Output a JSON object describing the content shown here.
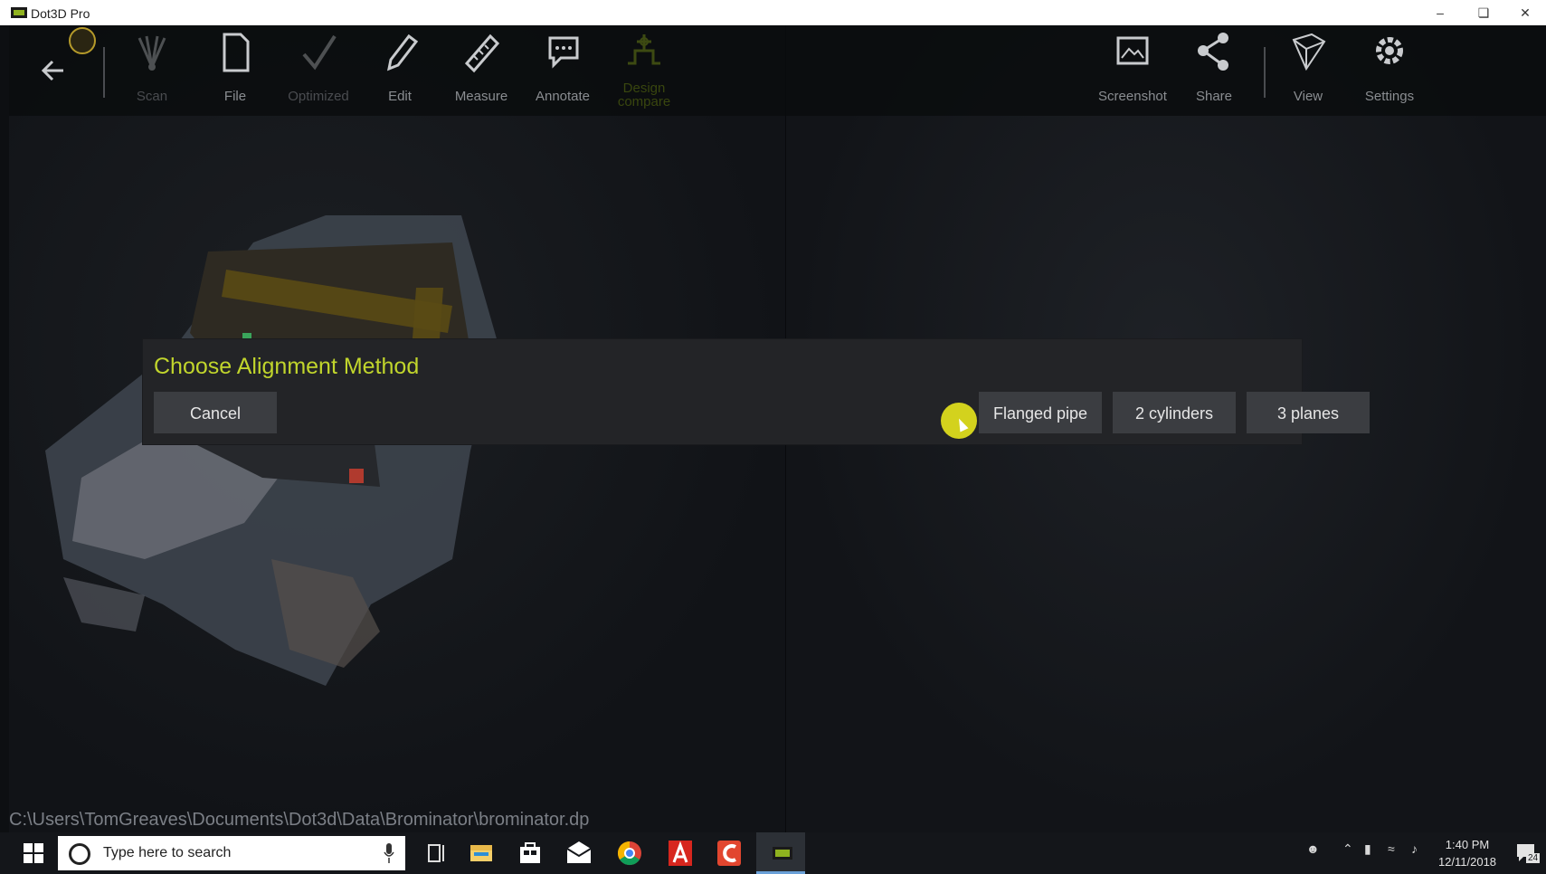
{
  "window": {
    "title": "Dot3D Pro",
    "min_icon": "minimize-icon",
    "restore_icon": "restore-icon",
    "close_icon": "close-icon"
  },
  "toolbar": {
    "left_tools": [
      {
        "label": "Scan",
        "icon": "scan-icon"
      },
      {
        "label": "File",
        "icon": "file-icon"
      },
      {
        "label": "Optimized",
        "icon": "check-icon"
      },
      {
        "label": "Edit",
        "icon": "pencil-icon"
      },
      {
        "label": "Measure",
        "icon": "ruler-icon"
      },
      {
        "label": "Annotate",
        "icon": "speech-bubble-icon"
      },
      {
        "label": "Design compare",
        "icon": "design-compare-icon"
      }
    ],
    "right_tools": [
      {
        "label": "Screenshot",
        "icon": "screenshot-icon"
      },
      {
        "label": "Share",
        "icon": "share-icon"
      },
      {
        "label": "View",
        "icon": "cube-icon"
      },
      {
        "label": "Settings",
        "icon": "gear-icon"
      }
    ]
  },
  "dialog": {
    "title": "Choose Alignment Method",
    "cancel_label": "Cancel",
    "options": [
      "Flanged pipe",
      "2 cylinders",
      "3 planes"
    ]
  },
  "status": {
    "path": "C:\\Users\\TomGreaves\\Documents\\Dot3d\\Data\\Brominator\\brominator.dp"
  },
  "taskbar": {
    "search_placeholder": "Type here to search",
    "clock_time": "1:40 PM",
    "clock_date": "12/11/2018",
    "notification_count": "24"
  },
  "colors": {
    "accent": "#c1d52c",
    "toolbar_bg": "#0a0c0e",
    "dialog_bg": "#232427",
    "button_bg": "#3b3d41",
    "cursor": "#e3e21c"
  }
}
